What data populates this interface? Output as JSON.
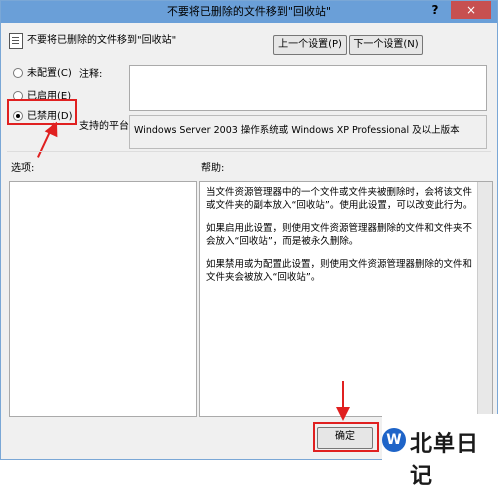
{
  "window": {
    "title": "不要将已删除的文件移到\"回收站\"",
    "help_btn": "?",
    "close_btn": "×"
  },
  "header": {
    "setting_name": "不要将已删除的文件移到\"回收站\"",
    "prev_btn": "上一个设置(P)",
    "next_btn": "下一个设置(N)"
  },
  "radios": [
    {
      "label": "未配置(C)",
      "checked": false
    },
    {
      "label": "已启用(E)",
      "checked": false
    },
    {
      "label": "已禁用(D)",
      "checked": true
    }
  ],
  "comment": {
    "label": "注释:",
    "value": ""
  },
  "platform": {
    "label": "支持的平台:",
    "value": "Windows Server 2003 操作系统或 Windows XP Professional 及以上版本"
  },
  "options": {
    "label": "选项:"
  },
  "help": {
    "label": "帮助:",
    "paragraphs": [
      "当文件资源管理器中的一个文件或文件夹被删除时，会将该文件或文件夹的副本放入“回收站”。使用此设置，可以改变此行为。",
      "如果启用此设置，则使用文件资源管理器删除的文件和文件夹不会放入“回收站”，而是被永久删除。",
      "如果禁用或为配置此设置，则使用文件资源管理器删除的文件和文件夹会被放入“回收站”。"
    ]
  },
  "footer": {
    "ok_btn": "确定"
  },
  "watermark": {
    "logo": "W",
    "text": "北单日记"
  },
  "colors": {
    "title_bar": "#6a9fd8",
    "annotation": "#e02020",
    "brand_blue": "#1e64c8"
  }
}
